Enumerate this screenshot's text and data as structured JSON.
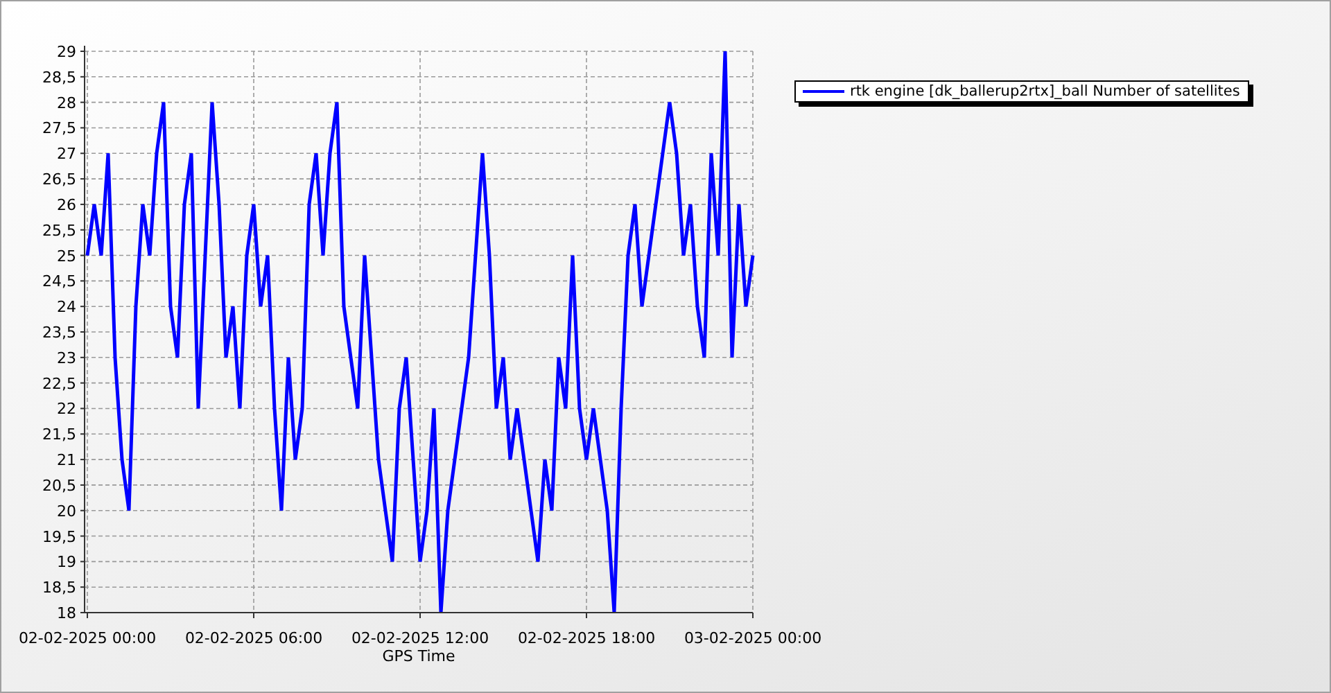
{
  "chart": {
    "chart_data": {
      "type": "line",
      "xlabel": "GPS Time",
      "grid": true,
      "categories": [
        "02-02-2025 00:00",
        null,
        null,
        null,
        null,
        null,
        null,
        null,
        null,
        null,
        null,
        null,
        null,
        null,
        null,
        null,
        null,
        null,
        null,
        null,
        null,
        null,
        null,
        null,
        "02-02-2025 06:00",
        null,
        null,
        null,
        null,
        null,
        null,
        null,
        null,
        null,
        null,
        null,
        null,
        null,
        null,
        null,
        null,
        null,
        null,
        null,
        null,
        null,
        null,
        null,
        "02-02-2025 12:00",
        null,
        null,
        null,
        null,
        null,
        null,
        null,
        null,
        null,
        null,
        null,
        null,
        null,
        null,
        null,
        null,
        null,
        null,
        null,
        null,
        null,
        null,
        null,
        "02-02-2025 18:00",
        null,
        null,
        null,
        null,
        null,
        null,
        null,
        null,
        null,
        null,
        null,
        null,
        null,
        null,
        null,
        null,
        null,
        null,
        null,
        null,
        null,
        null,
        null,
        "03-02-2025 00:00"
      ],
      "series": [
        {
          "name": "rtk engine [dk_ballerup2rtx]_ball Number of satellites",
          "color": "#0000ff",
          "values": [
            25,
            26,
            25,
            27,
            23,
            21,
            20,
            24,
            26,
            25,
            27,
            28,
            24,
            23,
            26,
            27,
            22,
            25,
            28,
            26,
            23,
            24,
            22,
            25,
            26,
            24,
            25,
            22,
            20,
            23,
            21,
            22,
            26,
            27,
            25,
            27,
            28,
            24,
            23,
            22,
            25,
            23,
            21,
            20,
            19,
            22,
            23,
            21,
            19,
            20,
            22,
            18,
            20,
            21,
            22,
            23,
            25,
            27,
            25,
            22,
            23,
            21,
            22,
            21,
            20,
            19,
            21,
            20,
            23,
            22,
            25,
            22,
            21,
            22,
            21,
            20,
            18,
            22,
            25,
            26,
            24,
            25,
            26,
            27,
            28,
            27,
            25,
            26,
            24,
            23,
            27,
            25,
            29,
            23,
            26,
            24,
            25
          ]
        }
      ],
      "ylim": [
        18,
        29
      ],
      "yticks": [
        {
          "value": 18,
          "label": "18"
        },
        {
          "value": 18.5,
          "label": "18,5"
        },
        {
          "value": 19,
          "label": "19"
        },
        {
          "value": 19.5,
          "label": "19,5"
        },
        {
          "value": 20,
          "label": "20"
        },
        {
          "value": 20.5,
          "label": "20,5"
        },
        {
          "value": 21,
          "label": "21"
        },
        {
          "value": 21.5,
          "label": "21,5"
        },
        {
          "value": 22,
          "label": "22"
        },
        {
          "value": 22.5,
          "label": "22,5"
        },
        {
          "value": 23,
          "label": "23"
        },
        {
          "value": 23.5,
          "label": "23,5"
        },
        {
          "value": 24,
          "label": "24"
        },
        {
          "value": 24.5,
          "label": "24,5"
        },
        {
          "value": 25,
          "label": "25"
        },
        {
          "value": 25.5,
          "label": "25,5"
        },
        {
          "value": 26,
          "label": "26"
        },
        {
          "value": 26.5,
          "label": "26,5"
        },
        {
          "value": 27,
          "label": "27"
        },
        {
          "value": 27.5,
          "label": "27,5"
        },
        {
          "value": 28,
          "label": "28"
        },
        {
          "value": 28.5,
          "label": "28,5"
        },
        {
          "value": 29,
          "label": "29"
        }
      ]
    }
  }
}
